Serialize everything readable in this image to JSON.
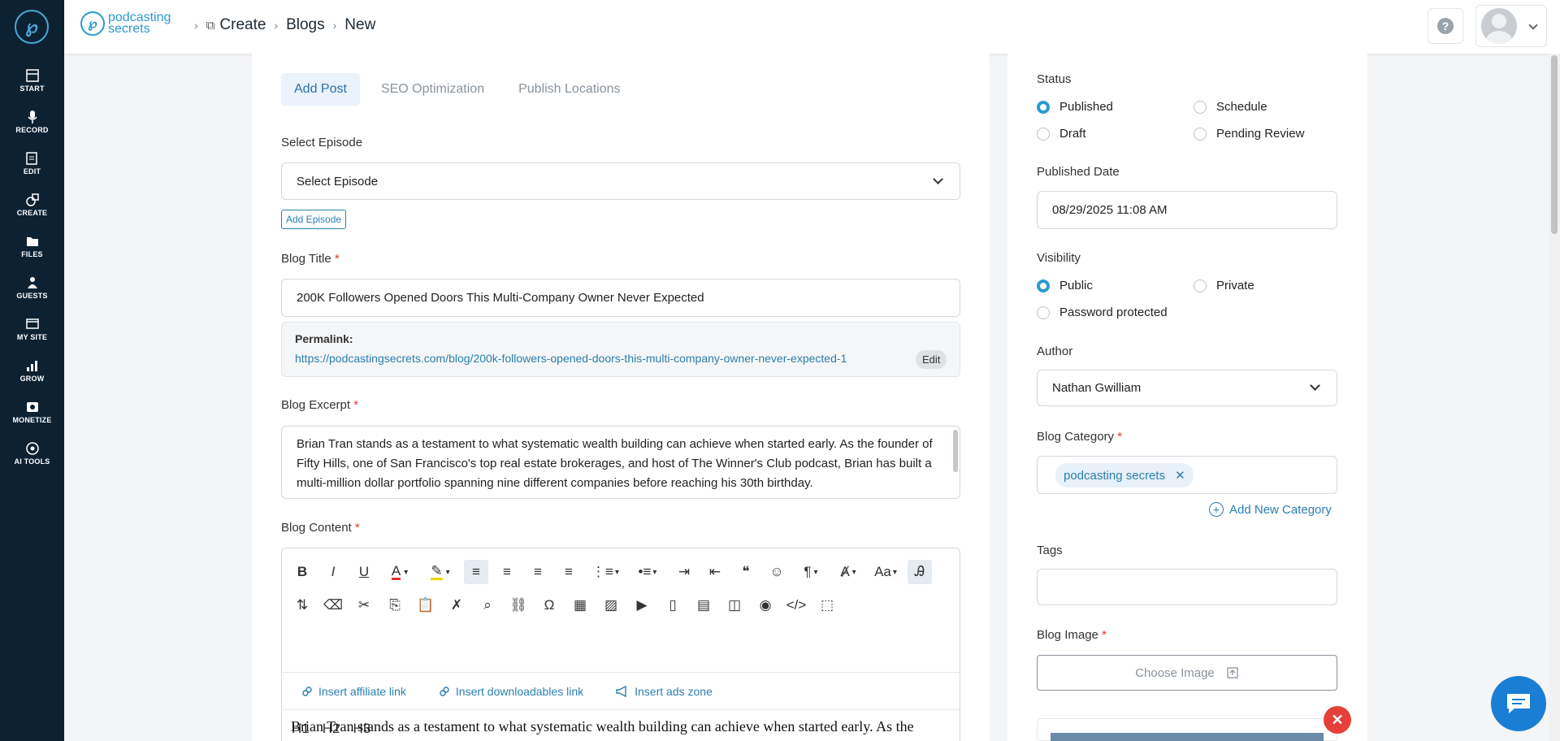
{
  "sidebar": {
    "items": [
      {
        "label": "START",
        "icon": "start-icon"
      },
      {
        "label": "RECORD",
        "icon": "mic-icon"
      },
      {
        "label": "EDIT",
        "icon": "edit-icon"
      },
      {
        "label": "CREATE",
        "icon": "create-icon"
      },
      {
        "label": "FILES",
        "icon": "files-icon"
      },
      {
        "label": "GUESTS",
        "icon": "guests-icon"
      },
      {
        "label": "MY SITE",
        "icon": "mysite-icon"
      },
      {
        "label": "GROW",
        "icon": "grow-icon"
      },
      {
        "label": "MONETIZE",
        "icon": "monetize-icon"
      },
      {
        "label": "AI TOOLS",
        "icon": "ai-tools-icon"
      }
    ]
  },
  "header": {
    "brand_line1": "podcasting",
    "brand_line2": "secrets",
    "breadcrumbs": [
      "Create",
      "Blogs",
      "New"
    ]
  },
  "tabs": [
    {
      "label": "Add Post",
      "active": true
    },
    {
      "label": "SEO Optimization",
      "active": false
    },
    {
      "label": "Publish Locations",
      "active": false
    }
  ],
  "form": {
    "episode_label": "Select Episode",
    "episode_value": "Select Episode",
    "add_episode_btn": "Add Episode",
    "title_label": "Blog Title",
    "title_value": "200K Followers Opened Doors This Multi-Company Owner Never  Expected",
    "permalink_label": "Permalink:",
    "permalink_url": "https://podcastingsecrets.com/blog/200k-followers-opened-doors-this-multi-company-owner-never-expected-1",
    "permalink_edit": "Edit",
    "excerpt_label": "Blog Excerpt",
    "excerpt_value": "Brian Tran stands as a testament to what systematic wealth building can achieve when started early. As the founder of Fifty Hills, one of San Francisco's top real estate brokerages, and host of The Winner's Club podcast, Brian has built a multi-million dollar portfolio spanning nine different companies before reaching his 30th birthday.",
    "content_label": "Blog Content",
    "required_mark": "*"
  },
  "editor": {
    "links": [
      "Insert affiliate link",
      "Insert downloadables link",
      "Insert ads zone"
    ],
    "headings": [
      "H1",
      "H2",
      "H3"
    ],
    "body_text": "Brian Tran stands as a testament to what systematic wealth building can achieve when started early. As the"
  },
  "side": {
    "status_label": "Status",
    "status_options": [
      "Published",
      "Schedule",
      "Draft",
      "Pending Review"
    ],
    "status_selected": "Published",
    "date_label": "Published Date",
    "date_value": "08/29/2025 11:08 AM",
    "visibility_label": "Visibility",
    "visibility_options": [
      "Public",
      "Private",
      "Password protected"
    ],
    "visibility_selected": "Public",
    "author_label": "Author",
    "author_value": "Nathan Gwilliam",
    "category_label": "Blog Category",
    "category_tag": "podcasting secrets",
    "add_category": "Add New Category",
    "tags_label": "Tags",
    "image_label": "Blog Image",
    "choose_image": "Choose Image"
  },
  "colors": {
    "accent": "#2a9bd0",
    "sidebar_bg": "#0c2233",
    "required": "#e0362b",
    "chat": "#1a7fd4",
    "close": "#e5403a"
  }
}
